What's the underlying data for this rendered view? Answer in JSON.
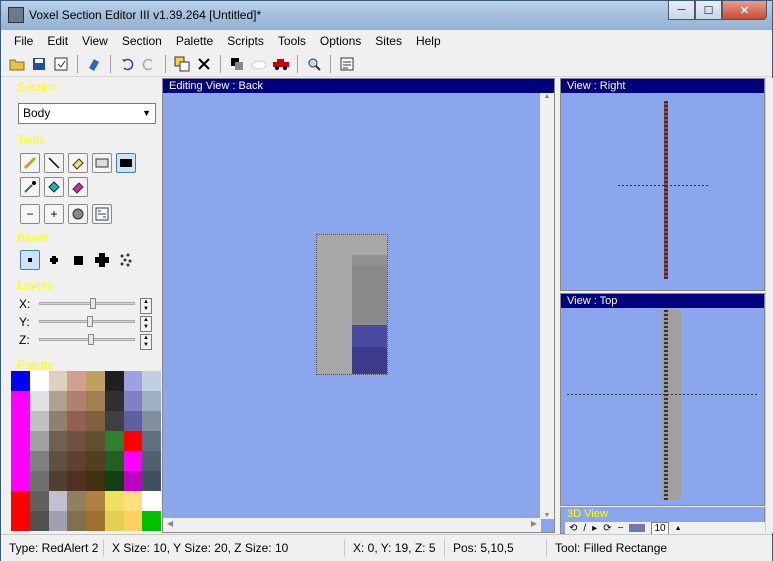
{
  "window": {
    "title": "Voxel Section Editor III v1.39.264 [Untitled]*",
    "minimize": "─",
    "maximize": "☐",
    "close": "✕"
  },
  "menu": [
    "File",
    "Edit",
    "View",
    "Section",
    "Palette",
    "Scripts",
    "Tools",
    "Options",
    "Sites",
    "Help"
  ],
  "left_panel": {
    "section_label": "Section",
    "section_value": "Body",
    "tools_label": "Tools",
    "brush_label": "Brush",
    "layers_label": "Layers",
    "layers": [
      {
        "axis": "X:",
        "level": 0.55
      },
      {
        "axis": "Y:",
        "level": 0.52
      },
      {
        "axis": "Z:",
        "level": 0.53
      }
    ],
    "palette_label": "Palette"
  },
  "views": {
    "editing": "Editing View : Back",
    "right": "View : Right",
    "top": "View : Top",
    "three_d": "3D View",
    "zoom_value": "10"
  },
  "status": {
    "type": "Type: RedAlert 2",
    "size": "X Size: 10, Y Size: 20, Z Size: 10",
    "coords": "X: 0, Y: 19, Z: 5",
    "pos": "Pos: 5,10,5",
    "tool": "Tool: Filled Rectange"
  },
  "colors": {
    "view_bg": "#8aa6ec",
    "title_bar": "#00007f",
    "section_label": "#ffff00"
  }
}
